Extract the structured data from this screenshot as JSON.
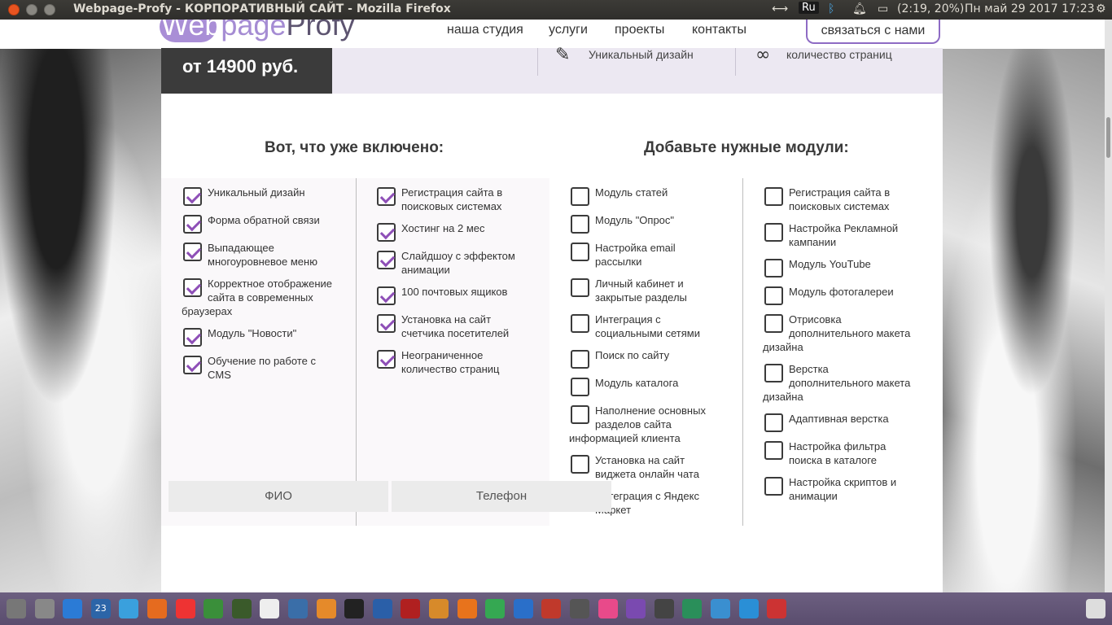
{
  "window": {
    "title": "Webpage-Profy - КОРПОРАТИВНЫЙ САЙТ - Mozilla Firefox"
  },
  "tray": {
    "keyboard": "Ru",
    "battery": "(2:19, 20%)",
    "datetime": "Пн май 29 2017 17:23"
  },
  "site": {
    "logo": {
      "web": "Web",
      "page": "page",
      "profy": "Profy"
    },
    "nav": [
      "наша студия",
      "услуги",
      "проекты",
      "контакты"
    ],
    "contact_button": "связаться с нами",
    "price": "от 14900 руб.",
    "features": [
      "Уникальный дизайн",
      "количество страниц"
    ]
  },
  "included": {
    "title": "Вот, что уже включено:",
    "col1": [
      [
        "Уникальный дизайн"
      ],
      [
        "Форма обратной связи"
      ],
      [
        "Выпадающее",
        "многоуровневое меню"
      ],
      [
        "Корректное отображение",
        "сайта в современных",
        "браузерах"
      ],
      [
        "Модуль \"Новости\""
      ],
      [
        "Обучение по работе с",
        "CMS"
      ]
    ],
    "col2": [
      [
        "Регистрация сайта в",
        "поисковых системах"
      ],
      [
        "Хостинг на 2 мес"
      ],
      [
        "Слайдшоу с эффектом",
        "анимации"
      ],
      [
        "100 почтовых ящиков"
      ],
      [
        "Установка на сайт",
        "счетчика посетителей"
      ],
      [
        "Неограниченное",
        "количество страниц"
      ]
    ]
  },
  "modules": {
    "title": "Добавьте нужные модули:",
    "col1": [
      [
        "Модуль статей"
      ],
      [
        "Модуль \"Опрос\""
      ],
      [
        "Настройка email",
        "рассылки"
      ],
      [
        "Личный кабинет и",
        "закрытые разделы"
      ],
      [
        "Интеграция с",
        "социальными сетями"
      ],
      [
        "Поиск по сайту"
      ],
      [
        "Модуль каталога"
      ],
      [
        "Наполнение основных",
        "разделов сайта",
        "информацией клиента"
      ],
      [
        "Установка на сайт",
        "виджета онлайн чата"
      ],
      [
        "Интеграция с Яндекс",
        "Маркет"
      ]
    ],
    "col2": [
      [
        "Регистрация сайта в",
        "поисковых системах"
      ],
      [
        "Настройка Рекламной",
        "кампании"
      ],
      [
        "Модуль YouTube"
      ],
      [
        "Модуль фотогалереи"
      ],
      [
        "Отрисовка",
        "дополнительного макета",
        "дизайна"
      ],
      [
        "Верстка",
        "дополнительного макета",
        "дизайна"
      ],
      [
        "Адаптивная верстка"
      ],
      [
        "Настройка фильтра",
        "поиска в каталоге"
      ],
      [
        "Настройка скриптов и",
        "анимации"
      ]
    ]
  },
  "form": {
    "name_placeholder": "ФИО",
    "phone_placeholder": "Телефон"
  },
  "dock": {
    "calendar_day": "23",
    "icons": [
      "launcher-icon",
      "settings-icon",
      "finder-icon",
      "calendar-icon",
      "mail-icon",
      "firefox-icon",
      "opera-icon",
      "chrome-icon",
      "app-icon",
      "notes-icon",
      "python-icon",
      "scratch-icon",
      "terminal-icon",
      "code-icon",
      "filezilla-icon",
      "gimp-icon",
      "blender-icon",
      "spreadsheet-icon",
      "document-icon",
      "presentation-icon",
      "system-settings-icon",
      "flower-icon",
      "video-icon",
      "calculator-icon",
      "chart-icon",
      "folder-icon",
      "download-icon",
      "update-icon",
      "trash-icon"
    ]
  }
}
